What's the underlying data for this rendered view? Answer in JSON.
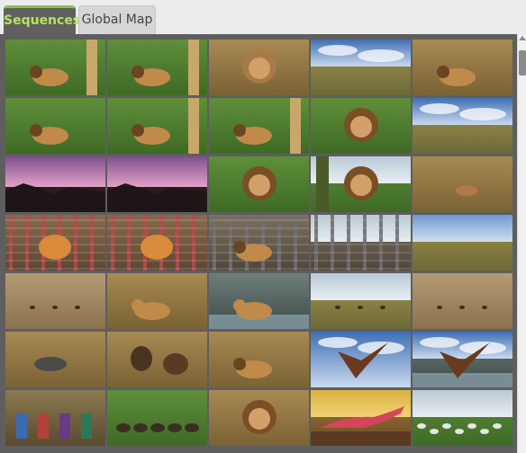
{
  "tabs": [
    {
      "label": "Sequences",
      "active": true
    },
    {
      "label": "Global Map",
      "active": false
    }
  ],
  "colors": {
    "active_tab_text": "#b6e35c",
    "active_tab_accent": "#8dc63f",
    "panel_background": "#5e5e5e"
  },
  "thumbnails": [
    {
      "subject": "lion-in-grass-behind-tree",
      "scene": "grass",
      "sky": "none",
      "animal": "lion",
      "tree": "right"
    },
    {
      "subject": "lion-lying-in-grass",
      "scene": "grass",
      "sky": "none",
      "animal": "lion",
      "tree": "right"
    },
    {
      "subject": "lioness-portrait",
      "scene": "dry",
      "sky": "none",
      "animal": "lioness-face",
      "tree": "none"
    },
    {
      "subject": "savanna-landscape-cloudy-sky",
      "scene": "plain",
      "sky": "blue-clouds",
      "animal": "none",
      "tree": "none"
    },
    {
      "subject": "lion-walking-dry-grass",
      "scene": "dry",
      "sky": "none",
      "animal": "lion",
      "tree": "none"
    },
    {
      "subject": "lions-resting-in-grass",
      "scene": "grass",
      "sky": "none",
      "animal": "lion",
      "tree": "none"
    },
    {
      "subject": "lion-behind-tree",
      "scene": "grass",
      "sky": "none",
      "animal": "lion",
      "tree": "right"
    },
    {
      "subject": "lion-lying-in-grass-2",
      "scene": "grass",
      "sky": "none",
      "animal": "lion",
      "tree": "right"
    },
    {
      "subject": "lion-sitting-portrait",
      "scene": "grass",
      "sky": "none",
      "animal": "lion-face",
      "tree": "none"
    },
    {
      "subject": "savanna-landscape-cloudy-sky-2",
      "scene": "plain",
      "sky": "blue-clouds",
      "animal": "none",
      "tree": "none"
    },
    {
      "subject": "purple-sunset-cliff",
      "scene": "cliff",
      "sky": "purple",
      "animal": "none",
      "tree": "none"
    },
    {
      "subject": "purple-sunset-hills",
      "scene": "cliff",
      "sky": "purple",
      "animal": "none",
      "tree": "none"
    },
    {
      "subject": "lion-in-bushes",
      "scene": "grass",
      "sky": "none",
      "animal": "lion-face",
      "tree": "none"
    },
    {
      "subject": "lion-closeup-valley",
      "scene": "grass",
      "sky": "pale",
      "animal": "lion-face",
      "tree": "left"
    },
    {
      "subject": "impala-in-bush",
      "scene": "dry",
      "sky": "none",
      "animal": "impala",
      "tree": "none"
    },
    {
      "subject": "tiger-behind-red-fence",
      "scene": "fence",
      "sky": "none",
      "animal": "tiger",
      "tree": "none"
    },
    {
      "subject": "tiger-behind-red-fence-2",
      "scene": "fence",
      "sky": "none",
      "animal": "tiger",
      "tree": "none"
    },
    {
      "subject": "lion-enclosure",
      "scene": "enclosure",
      "sky": "none",
      "animal": "lion",
      "tree": "none"
    },
    {
      "subject": "enclosure-fence-field",
      "scene": "enclosure",
      "sky": "pale",
      "animal": "none",
      "tree": "none"
    },
    {
      "subject": "tall-grass-field",
      "scene": "plain",
      "sky": "blue",
      "animal": "none",
      "tree": "none"
    },
    {
      "subject": "cheetah-distant-dry-plain",
      "scene": "sand",
      "sky": "none",
      "animal": "small",
      "tree": "none"
    },
    {
      "subject": "lioness-walking-toward-camera",
      "scene": "dry",
      "sky": "none",
      "animal": "lioness",
      "tree": "none"
    },
    {
      "subject": "lioness-drinking-water",
      "scene": "water",
      "sky": "none",
      "animal": "lioness",
      "tree": "none"
    },
    {
      "subject": "dry-plain-animals-distance",
      "scene": "plain",
      "sky": "pale",
      "animal": "small",
      "tree": "none"
    },
    {
      "subject": "dry-savanna-grazers",
      "scene": "sand",
      "sky": "none",
      "animal": "small",
      "tree": "none"
    },
    {
      "subject": "wildebeest-dry-grass",
      "scene": "dry",
      "sky": "none",
      "animal": "wildebeest",
      "tree": "none"
    },
    {
      "subject": "vultures-feeding",
      "scene": "dry",
      "sky": "none",
      "animal": "bird",
      "tree": "none"
    },
    {
      "subject": "lion-with-prey",
      "scene": "dry",
      "sky": "none",
      "animal": "lion",
      "tree": "none"
    },
    {
      "subject": "bird-of-prey-flying",
      "scene": "sky",
      "sky": "blue-clouds",
      "animal": "eagle",
      "tree": "none"
    },
    {
      "subject": "eagle-over-lake",
      "scene": "water",
      "sky": "blue-clouds",
      "animal": "eagle",
      "tree": "none"
    },
    {
      "subject": "maasai-people-gathering",
      "scene": "people",
      "sky": "none",
      "animal": "people",
      "tree": "none"
    },
    {
      "subject": "cattle-herd-grassland",
      "scene": "grass",
      "sky": "none",
      "animal": "cattle",
      "tree": "none"
    },
    {
      "subject": "male-lion-closeup",
      "scene": "dry",
      "sky": "none",
      "animal": "lion-face",
      "tree": "none"
    },
    {
      "subject": "red-agama-lizard",
      "scene": "rock",
      "sky": "yellow",
      "animal": "lizard",
      "tree": "none"
    },
    {
      "subject": "zebra-herd-savanna",
      "scene": "grass",
      "sky": "pale",
      "animal": "zebra",
      "tree": "none"
    }
  ]
}
